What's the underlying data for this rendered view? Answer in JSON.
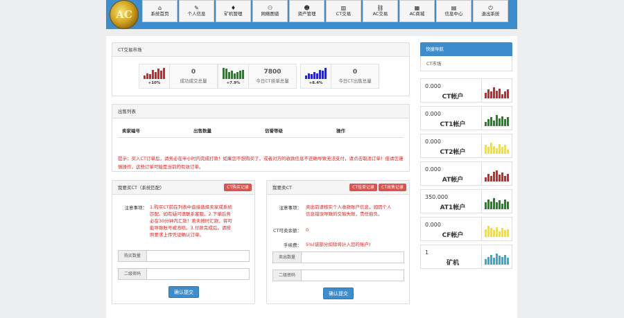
{
  "logo": {
    "text": "AC"
  },
  "nav": [
    {
      "icon": "⌂",
      "label": "系统首页"
    },
    {
      "icon": "✎",
      "label": "个人信息"
    },
    {
      "icon": "♦",
      "label": "矿机管理"
    },
    {
      "icon": "⚇",
      "label": "网络图谱"
    },
    {
      "icon": "☻",
      "label": "资产管理"
    },
    {
      "icon": "▥",
      "label": "CT交易"
    },
    {
      "icon": "⛓",
      "label": "AC交易"
    },
    {
      "icon": "▦",
      "label": "AC商城"
    },
    {
      "icon": "▤",
      "label": "信息中心"
    },
    {
      "icon": "⏻",
      "label": "退出系统"
    }
  ],
  "ct_trend": {
    "title": "CT交易市场",
    "stats": [
      {
        "pct": "+10%",
        "value": "0",
        "label": "成功成交总量",
        "color": "#e02020",
        "bars": [
          0.3,
          0.5,
          0.4,
          0.8,
          0.6,
          0.9,
          0.7,
          1.0
        ]
      },
      {
        "pct": "+7.9%",
        "value": "7800",
        "label": "今日CT挂单总量",
        "color": "#1a8a1a",
        "bars": [
          1.0,
          0.9,
          0.6,
          0.7,
          0.5,
          0.6,
          0.7,
          0.8
        ]
      },
      {
        "pct": "+8.4%",
        "value": "0",
        "label": "今日CT出售总量",
        "color": "#2323d8",
        "bars": [
          0.3,
          0.5,
          0.4,
          0.6,
          0.5,
          0.8,
          0.7,
          1.0
        ]
      }
    ]
  },
  "sell_list": {
    "title": "出售列表",
    "columns": [
      "卖家编号",
      "出售数量",
      "信誉等级",
      "操作"
    ],
    "warning": "提示：买入CT订单后，请务必在半小时内完成打款！如果您不想购买了，或者对方的收款信息不正确导致无法支付，请点击取消订单！但请您谨慎操作，这些订单可能是当前的有效订单。"
  },
  "buy_panel": {
    "title": "我要买CT（系统匹配）",
    "record_btn": "CT购买记录",
    "notice_label": "注意事项：",
    "notice_text": "1.购买CT前在列表中直接选择卖家或系统匹配。如有疑问请联系客服。2.下单后务必在30分钟内汇款！若未按时汇款，将可能导致账号被冻结。3.付款完成后，请按照要求上传凭证确认订单。",
    "amount_addon": "购买数量",
    "password_addon": "二级密码",
    "submit": "确认提交"
  },
  "sell_panel": {
    "title": "我要卖CT",
    "btn1": "CT挂单记录",
    "btn2": "CT出售记录",
    "notice_label": "注意事项：",
    "notice_text": "卖出前请核实个人收款账户信息，如因个人信息错误导致的交易失败，责任自负。",
    "available_label": "CT可卖余额：",
    "available_value": "0",
    "fee_label": "手续费：",
    "fee_value": "5%(该部分扣除将计入您的账户)",
    "amount_addon": "卖出数量",
    "password_addon": "二级密码",
    "submit": "确认提交"
  },
  "sidebar": {
    "header": "快捷导航",
    "link": "CT市场",
    "accounts": [
      {
        "value": "0.000",
        "name": "CT帐户",
        "color": "#e02020",
        "bars": [
          0.5,
          0.8,
          0.6,
          1.0,
          0.7,
          0.9,
          0.4,
          0.6,
          0.8
        ]
      },
      {
        "value": "0.000",
        "name": "CT1帐户",
        "color": "#1a8a1a",
        "bars": [
          0.4,
          0.6,
          0.8,
          0.5,
          1.0,
          0.7,
          0.9,
          0.6,
          0.8
        ]
      },
      {
        "value": "0.000",
        "name": "CT2帐户",
        "color": "#ffe600",
        "bars": [
          0.8,
          0.6,
          1.0,
          0.7,
          0.5,
          0.9,
          0.6,
          0.8,
          0.4
        ]
      },
      {
        "value": "0.000",
        "name": "AT帐户",
        "color": "#e02020",
        "bars": [
          0.4,
          0.7,
          0.5,
          0.9,
          1.0,
          0.6,
          0.8,
          0.5,
          0.7
        ]
      },
      {
        "value": "350.000",
        "name": "AT1帐户",
        "color": "#1a8a1a",
        "bars": [
          0.6,
          0.9,
          0.7,
          1.0,
          0.6,
          0.8,
          0.5,
          0.9,
          0.7
        ]
      },
      {
        "value": "0.000",
        "name": "CF帐户",
        "color": "#ffe600",
        "bars": [
          0.7,
          1.0,
          0.8,
          0.6,
          0.9,
          0.5,
          0.8,
          0.6,
          0.7
        ]
      },
      {
        "value": "1",
        "name": "矿机",
        "color": "#2ab0d8",
        "bars": [
          0.5,
          0.7,
          0.9,
          0.6,
          1.0,
          0.8,
          0.7,
          0.9,
          0.6
        ]
      }
    ]
  }
}
